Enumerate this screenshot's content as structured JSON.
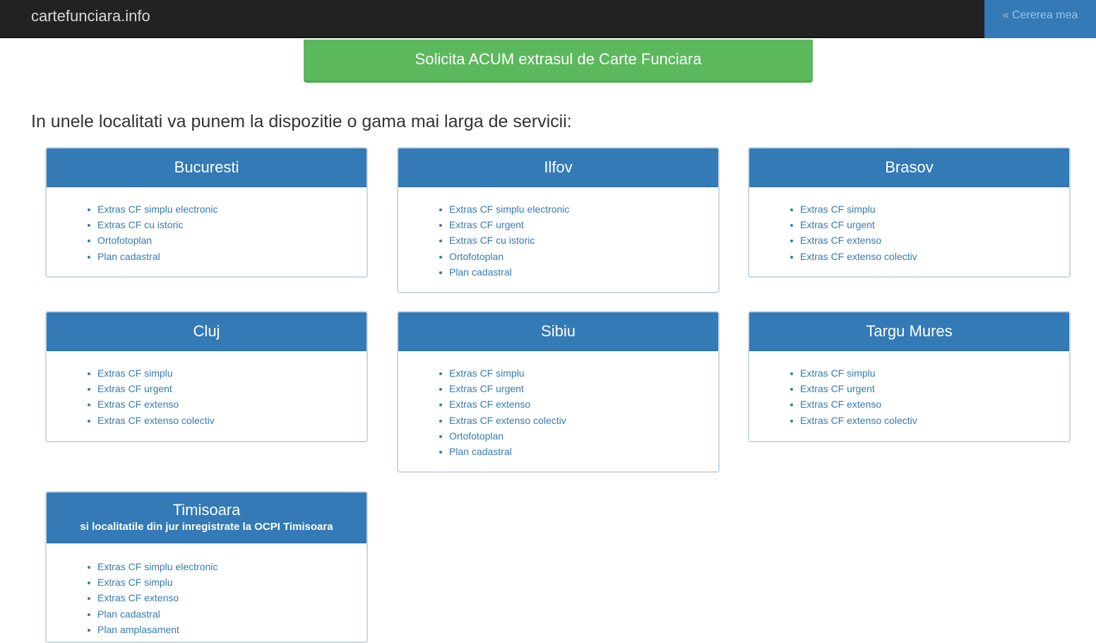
{
  "navbar": {
    "brand": "cartefunciara.info",
    "cart_label": "« Cererea mea"
  },
  "cta": {
    "label": "Solicita ACUM extrasul de Carte Funciara",
    "color": "#5cb85c"
  },
  "intro": "In unele localitati va punem la dispozitie o gama mai larga de servicii:",
  "accent_color": "#337ab7",
  "regions": [
    {
      "title": "Bucuresti",
      "subtitle": "",
      "services": [
        "Extras CF simplu electronic",
        "Extras CF cu istoric",
        "Ortofotoplan",
        "Plan cadastral"
      ]
    },
    {
      "title": "Ilfov",
      "subtitle": "",
      "services": [
        "Extras CF simplu electronic",
        "Extras CF urgent",
        "Extras CF cu istoric",
        "Ortofotoplan",
        "Plan cadastral"
      ]
    },
    {
      "title": "Brasov",
      "subtitle": "",
      "services": [
        "Extras CF simplu",
        "Extras CF urgent",
        "Extras CF extenso",
        "Extras CF extenso colectiv"
      ]
    },
    {
      "title": "Cluj",
      "subtitle": "",
      "services": [
        "Extras CF simplu",
        "Extras CF urgent",
        "Extras CF extenso",
        "Extras CF extenso colectiv"
      ]
    },
    {
      "title": "Sibiu",
      "subtitle": "",
      "services": [
        "Extras CF simplu",
        "Extras CF urgent",
        "Extras CF extenso",
        "Extras CF extenso colectiv",
        "Ortofotoplan",
        "Plan cadastral"
      ]
    },
    {
      "title": "Targu Mures",
      "subtitle": "",
      "services": [
        "Extras CF simplu",
        "Extras CF urgent",
        "Extras CF extenso",
        "Extras CF extenso colectiv"
      ]
    },
    {
      "title": "Timisoara",
      "subtitle": "si localitatile din jur inregistrate la OCPI Timisoara",
      "services": [
        "Extras CF simplu electronic",
        "Extras CF simplu",
        "Extras CF extenso",
        "Plan cadastral",
        "Plan amplasament"
      ]
    }
  ]
}
